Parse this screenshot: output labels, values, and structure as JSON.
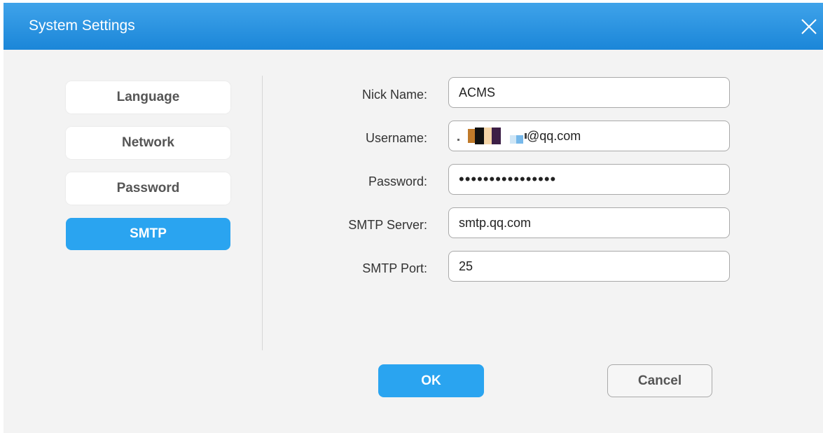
{
  "window": {
    "title": "System Settings",
    "close_icon": "close-icon"
  },
  "sidebar": {
    "items": [
      {
        "label": "Language",
        "active": false
      },
      {
        "label": "Network",
        "active": false
      },
      {
        "label": "Password",
        "active": false
      },
      {
        "label": "SMTP",
        "active": true
      }
    ]
  },
  "form": {
    "nick_name": {
      "label": "Nick Name:",
      "value": "ACMS"
    },
    "username": {
      "label": "Username:",
      "value_suffix": "@qq.com"
    },
    "password": {
      "label": "Password:",
      "value": "••••••••••••••••"
    },
    "smtp_server": {
      "label": "SMTP Server:",
      "value": "smtp.qq.com"
    },
    "smtp_port": {
      "label": "SMTP Port:",
      "value": "25"
    }
  },
  "actions": {
    "ok_label": "OK",
    "cancel_label": "Cancel"
  },
  "colors": {
    "accent": "#2aa4f0",
    "titlebar_top": "#3fa3ea",
    "titlebar_bottom": "#1b86d8",
    "dialog_bg": "#f3f3f3"
  }
}
